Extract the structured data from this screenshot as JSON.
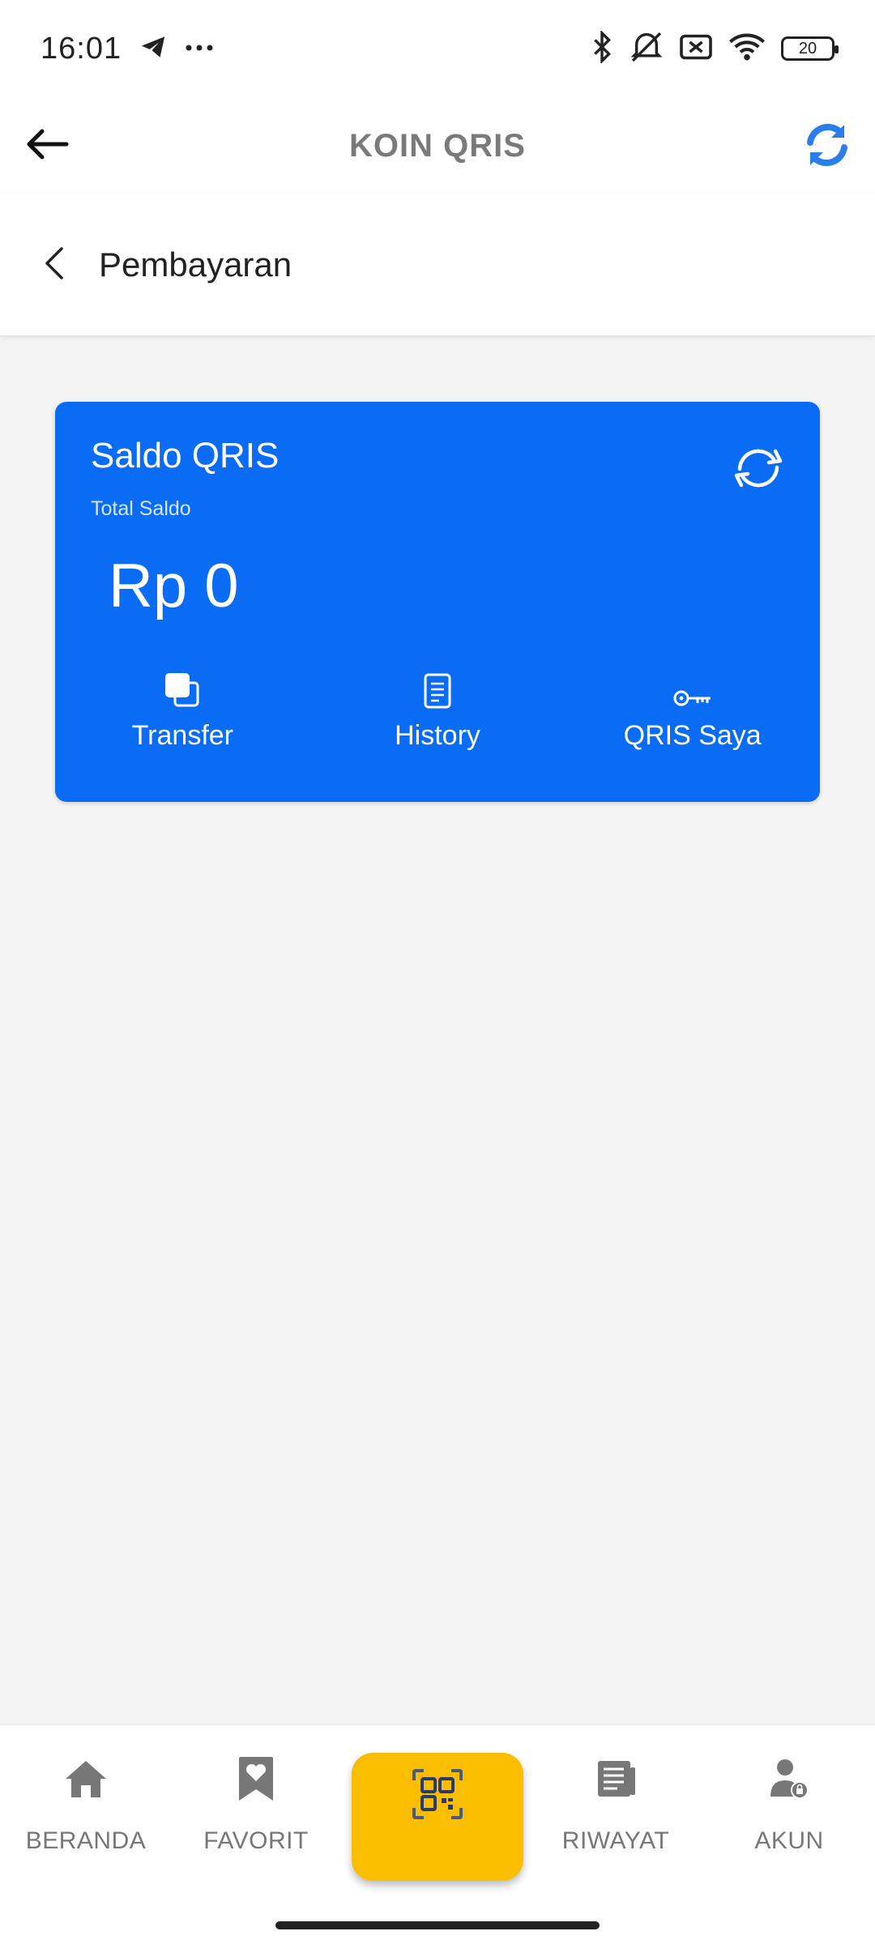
{
  "status_bar": {
    "time": "16:01",
    "battery": "20"
  },
  "app_bar": {
    "title": "KOIN QRIS"
  },
  "sub_header": {
    "title": "Pembayaran"
  },
  "card": {
    "title": "Saldo QRIS",
    "subtitle": "Total Saldo",
    "amount": "Rp 0",
    "actions": [
      {
        "label": "Transfer",
        "icon": "copy-icon"
      },
      {
        "label": "History",
        "icon": "document-icon"
      },
      {
        "label": "QRIS Saya",
        "icon": "key-icon"
      }
    ]
  },
  "bottom_nav": {
    "items": [
      {
        "label": "BERANDA",
        "icon": "home-icon"
      },
      {
        "label": "FAVORIT",
        "icon": "bookmark-heart-icon"
      },
      {
        "label": "",
        "icon": "qr-scan-icon"
      },
      {
        "label": "RIWAYAT",
        "icon": "newspaper-icon"
      },
      {
        "label": "AKUN",
        "icon": "user-lock-icon"
      }
    ]
  },
  "colors": {
    "card_blue": "#0a6cf5",
    "refresh_blue": "#2b7de9",
    "nav_center_yellow": "#fbbd00",
    "nav_grey": "#777777"
  }
}
